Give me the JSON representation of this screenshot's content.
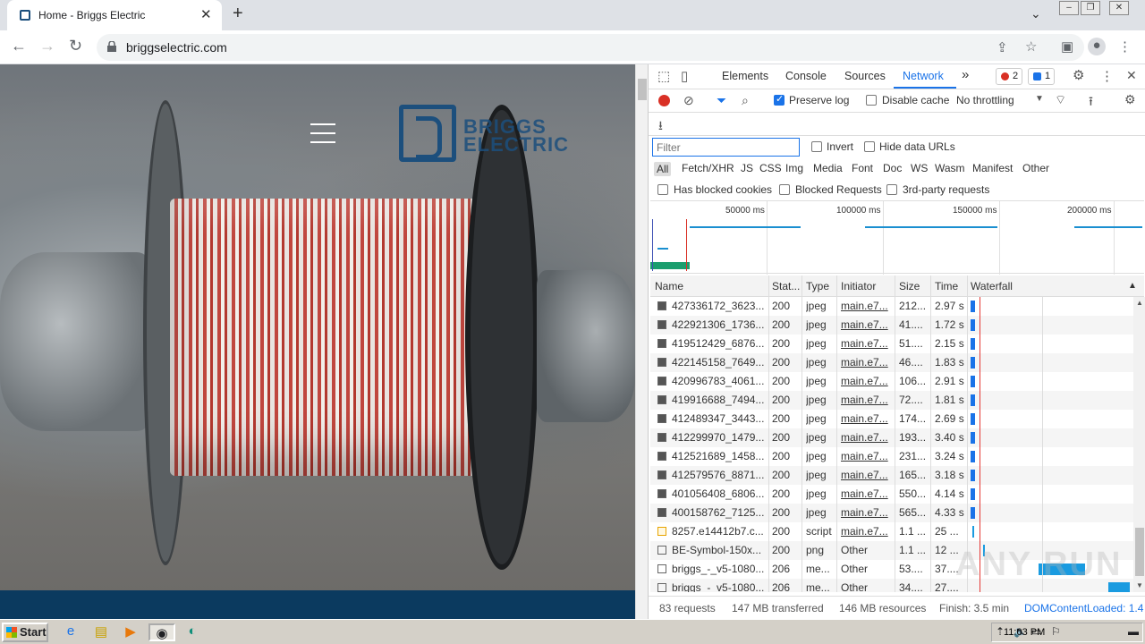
{
  "browser": {
    "tab_title": "Home - Briggs Electric",
    "close_tab": "✕",
    "new_tab": "+",
    "url": "briggselectric.com"
  },
  "site": {
    "logo_line1": "BRIGGS",
    "logo_line2": "ELECTRIC"
  },
  "devtools": {
    "tabs": [
      "Elements",
      "Console",
      "Sources",
      "Network"
    ],
    "more_tabs": "»",
    "errors_count": "2",
    "messages_count": "1",
    "preserve_log_label": "Preserve log",
    "preserve_log_checked": true,
    "disable_cache_label": "Disable cache",
    "throttling": "No throttling",
    "filter_placeholder": "Filter",
    "invert_label": "Invert",
    "hide_data_urls_label": "Hide data URLs",
    "type_filters": [
      "All",
      "Fetch/XHR",
      "JS",
      "CSS",
      "Img",
      "Media",
      "Font",
      "Doc",
      "WS",
      "Wasm",
      "Manifest",
      "Other"
    ],
    "blocked_cookies_label": "Has blocked cookies",
    "blocked_requests_label": "Blocked Requests",
    "third_party_label": "3rd-party requests",
    "timeline_ticks": [
      "50000 ms",
      "100000 ms",
      "150000 ms",
      "200000 ms"
    ],
    "columns": [
      "Name",
      "Stat...",
      "Type",
      "Initiator",
      "Size",
      "Time",
      "Waterfall"
    ],
    "rows": [
      {
        "name": "427336172_3623...",
        "status": "200",
        "type": "jpeg",
        "initiator": "main.e7...",
        "size": "212...",
        "time": "2.97 s",
        "kind": "img"
      },
      {
        "name": "422921306_1736...",
        "status": "200",
        "type": "jpeg",
        "initiator": "main.e7...",
        "size": "41....",
        "time": "1.72 s",
        "kind": "img"
      },
      {
        "name": "419512429_6876...",
        "status": "200",
        "type": "jpeg",
        "initiator": "main.e7...",
        "size": "51....",
        "time": "2.15 s",
        "kind": "img"
      },
      {
        "name": "422145158_7649...",
        "status": "200",
        "type": "jpeg",
        "initiator": "main.e7...",
        "size": "46....",
        "time": "1.83 s",
        "kind": "img"
      },
      {
        "name": "420996783_4061...",
        "status": "200",
        "type": "jpeg",
        "initiator": "main.e7...",
        "size": "106...",
        "time": "2.91 s",
        "kind": "img"
      },
      {
        "name": "419916688_7494...",
        "status": "200",
        "type": "jpeg",
        "initiator": "main.e7...",
        "size": "72....",
        "time": "1.81 s",
        "kind": "img"
      },
      {
        "name": "412489347_3443...",
        "status": "200",
        "type": "jpeg",
        "initiator": "main.e7...",
        "size": "174...",
        "time": "2.69 s",
        "kind": "img"
      },
      {
        "name": "412299970_1479...",
        "status": "200",
        "type": "jpeg",
        "initiator": "main.e7...",
        "size": "193...",
        "time": "3.40 s",
        "kind": "img"
      },
      {
        "name": "412521689_1458...",
        "status": "200",
        "type": "jpeg",
        "initiator": "main.e7...",
        "size": "231...",
        "time": "3.24 s",
        "kind": "img"
      },
      {
        "name": "412579576_8871...",
        "status": "200",
        "type": "jpeg",
        "initiator": "main.e7...",
        "size": "165...",
        "time": "3.18 s",
        "kind": "img"
      },
      {
        "name": "401056408_6806...",
        "status": "200",
        "type": "jpeg",
        "initiator": "main.e7...",
        "size": "550...",
        "time": "4.14 s",
        "kind": "img"
      },
      {
        "name": "400158762_7125...",
        "status": "200",
        "type": "jpeg",
        "initiator": "main.e7...",
        "size": "565...",
        "time": "4.33 s",
        "kind": "img"
      },
      {
        "name": "8257.e14412b7.c...",
        "status": "200",
        "type": "script",
        "initiator": "main.e7...",
        "size": "1.1 ...",
        "time": "25 ...",
        "kind": "js"
      },
      {
        "name": "BE-Symbol-150x...",
        "status": "200",
        "type": "png",
        "initiator": "Other",
        "size": "1.1 ...",
        "time": "12 ...",
        "kind": "doc"
      },
      {
        "name": "briggs_-_v5-1080...",
        "status": "206",
        "type": "me...",
        "initiator": "Other",
        "size": "53....",
        "time": "37....",
        "kind": "doc"
      },
      {
        "name": "briggs_-_v5-1080...",
        "status": "206",
        "type": "me...",
        "initiator": "Other",
        "size": "34....",
        "time": "27....",
        "kind": "doc"
      }
    ],
    "status": {
      "requests": "83 requests",
      "transferred": "147 MB transferred",
      "resources": "146 MB resources",
      "finish": "Finish: 3.5 min",
      "dcl": "DOMContentLoaded: 1.4"
    }
  },
  "watermark": "ANY RUN",
  "taskbar": {
    "start_label": "Start",
    "clock": "11:03 PM"
  },
  "colors": {
    "accent": "#1a73e8",
    "brand": "#1c4f7d",
    "page_band": "#0b3a5f"
  }
}
